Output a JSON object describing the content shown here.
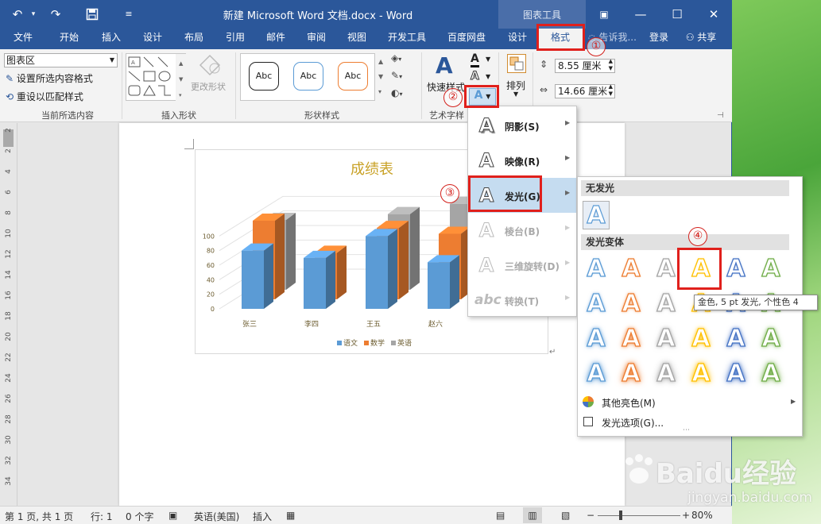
{
  "window": {
    "title": "新建 Microsoft Word 文档.docx - Word",
    "context_tab_group": "图表工具",
    "controls": {
      "ribbon": "▣",
      "minimize": "—",
      "maximize": "☐",
      "close": "✕"
    },
    "quick_access": {
      "undo": "↶",
      "undo_more": "▾",
      "redo": "↷",
      "save": "💾",
      "customize": "≡"
    }
  },
  "tabs": [
    {
      "label": "文件"
    },
    {
      "label": "开始"
    },
    {
      "label": "插入"
    },
    {
      "label": "设计"
    },
    {
      "label": "布局"
    },
    {
      "label": "引用"
    },
    {
      "label": "邮件"
    },
    {
      "label": "审阅"
    },
    {
      "label": "视图"
    },
    {
      "label": "开发工具"
    },
    {
      "label": "百度网盘"
    },
    {
      "label": "设计"
    },
    {
      "label": "格式"
    }
  ],
  "tellme": "告诉我...",
  "login": "登录",
  "share": "共享",
  "ribbon": {
    "current_selection": {
      "combo_value": "图表区",
      "set_format": "设置所选内容格式",
      "reset_style": "重设以匹配样式",
      "label": "当前所选内容"
    },
    "insert_shapes": {
      "label": "插入形状",
      "change_shape": "更改形状"
    },
    "shape_styles": {
      "label": "形状样式",
      "sample": "Abc"
    },
    "wordart": {
      "label": "艺术字样",
      "quick_styles": "快速样式"
    },
    "arrange": {
      "label": "排列"
    },
    "size": {
      "height": "8.55 厘米",
      "width": "14.66 厘米"
    }
  },
  "chart_data": {
    "type": "bar",
    "title": "成绩表",
    "categories": [
      "张三",
      "李四",
      "王五",
      "赵六"
    ],
    "series": [
      {
        "name": "语文",
        "values": [
          80,
          70,
          100,
          64
        ]
      },
      {
        "name": "数学",
        "values": [
          108,
          64,
          98,
          90
        ]
      },
      {
        "name": "英语",
        "values": [
          96,
          0,
          104,
          118
        ]
      }
    ],
    "yticks": [
      "0",
      "20",
      "40",
      "60",
      "80",
      "100"
    ],
    "ylim": [
      0,
      120
    ],
    "legend": "bottom",
    "colors": {
      "语文": "#5b9bd5",
      "数学": "#ed7d31",
      "英语": "#a5a5a5"
    }
  },
  "menu": {
    "items": [
      {
        "glyph": "A",
        "label": "阴影(S)",
        "enabled": true
      },
      {
        "glyph": "A",
        "label": "映像(R)",
        "enabled": true
      },
      {
        "glyph": "A",
        "label": "发光(G)",
        "enabled": true,
        "highlighted": true
      },
      {
        "glyph": "A",
        "label": "棱台(B)",
        "enabled": false
      },
      {
        "glyph": "A",
        "label": "三维旋转(D)",
        "enabled": false
      },
      {
        "glyph": "abc",
        "label": "转换(T)",
        "enabled": false
      }
    ],
    "arrow": "▶"
  },
  "glow": {
    "no_glow": "无发光",
    "variants": "发光变体",
    "more_colors": "其他亮色(M)",
    "options": "发光选项(G)...",
    "grid_colors": [
      "#5b9bd5",
      "#ed7d31",
      "#a5a5a5",
      "#ffc000",
      "#4472c4",
      "#70ad47"
    ],
    "tooltip": "金色, 5 pt 发光, 个性色 4"
  },
  "annotations": [
    "①",
    "②",
    "③",
    "④"
  ],
  "ruler": [
    "2",
    "2",
    "4",
    "6",
    "8",
    "10",
    "12",
    "14",
    "16",
    "18",
    "20",
    "22",
    "24",
    "26",
    "28",
    "30",
    "32",
    "34"
  ],
  "status": {
    "page": "第 1 页, 共 1 页",
    "row": "行: 1",
    "chars": "0 个字",
    "lang": "英语(美国)",
    "mode": "插入",
    "zoom": "80%"
  },
  "watermark": {
    "brand": "Baidu经验",
    "url": "jingyan.baidu.com"
  }
}
